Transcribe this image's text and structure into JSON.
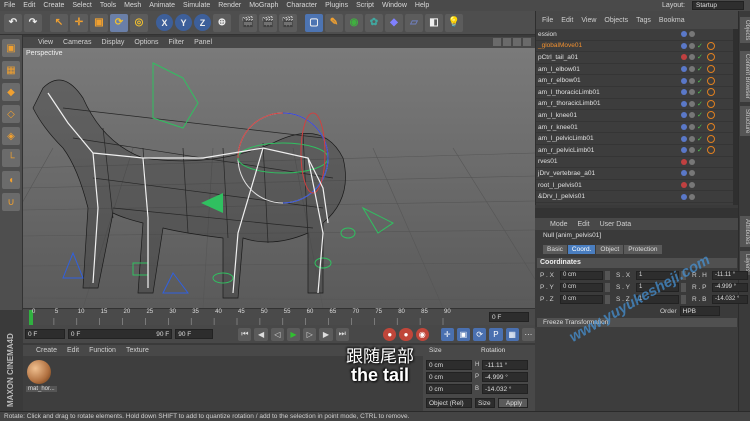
{
  "menubar": {
    "items": [
      "File",
      "Edit",
      "Create",
      "Select",
      "Tools",
      "Mesh",
      "Animate",
      "Simulate",
      "Render",
      "MoGraph",
      "Character",
      "Plugins",
      "Script",
      "Window",
      "Help"
    ],
    "layout_label": "Layout:",
    "layout_value": "Startup"
  },
  "toolbar": {
    "axis_x": "X",
    "axis_y": "Y",
    "axis_z": "Z"
  },
  "viewport": {
    "menu": [
      "View",
      "Cameras",
      "Display",
      "Options",
      "Filter",
      "Panel"
    ],
    "label": "Perspective"
  },
  "timeline": {
    "ticks": [
      "0",
      "5",
      "10",
      "15",
      "20",
      "25",
      "30",
      "35",
      "40",
      "45",
      "50",
      "55",
      "60",
      "65",
      "70",
      "75",
      "80",
      "85",
      "90"
    ],
    "current_frame": "0 F"
  },
  "transport": {
    "start_field": "0 F",
    "start_range": "0 F",
    "end_range": "90 F",
    "end_field": "90 F"
  },
  "material_manager": {
    "menu": [
      "Create",
      "Edit",
      "Function",
      "Texture"
    ],
    "material_name": "mat_hor..."
  },
  "coordinates_manager": {
    "col_size": "Size",
    "col_rotation": "Rotation",
    "size_values": [
      "0 cm",
      "0 cm",
      "0 cm"
    ],
    "rotation_labels": [
      "H",
      "P",
      "B"
    ],
    "rotation_values": [
      "-11.11 °",
      "-4.999 °",
      "-14.032 °"
    ],
    "mode_object": "Object (Rel)",
    "mode_size": "Size",
    "apply": "Apply"
  },
  "subtitle": {
    "chinese": "跟随尾部",
    "english": "the tail"
  },
  "watermark": "www.yuyukesheji.com",
  "object_manager": {
    "menu": [
      "File",
      "Edit",
      "View",
      "Objects",
      "Tags",
      "Bookma"
    ],
    "objects": [
      {
        "name": "ession",
        "highlight": false
      },
      {
        "name": "_globalMove01",
        "highlight": true
      },
      {
        "name": "pCtrl_tail_a01",
        "highlight": false
      },
      {
        "name": "am_l_elbow01",
        "highlight": false
      },
      {
        "name": "am_r_elbow01",
        "highlight": false
      },
      {
        "name": "am_l_thoracicLimb01",
        "highlight": false
      },
      {
        "name": "am_r_thoracicLimb01",
        "highlight": false
      },
      {
        "name": "am_l_knee01",
        "highlight": false
      },
      {
        "name": "am_r_knee01",
        "highlight": false
      },
      {
        "name": "am_l_pelvicLimb01",
        "highlight": false
      },
      {
        "name": "am_r_pelvicLimb01",
        "highlight": false
      },
      {
        "name": "rves01",
        "highlight": false
      },
      {
        "name": "jDrv_vertebrae_a01",
        "highlight": false
      },
      {
        "name": "root_l_pelvis01",
        "highlight": false
      },
      {
        "name": "&Drv_l_pelvis01",
        "highlight": false
      }
    ]
  },
  "attribute_manager": {
    "menu": [
      "Mode",
      "Edit",
      "User Data"
    ],
    "object_line": "Null [anim_pelvis01]",
    "tabs": [
      "Basic",
      "Coord.",
      "Object",
      "Protection"
    ],
    "active_tab": "Coord.",
    "section": "Coordinates",
    "rows": [
      {
        "p_label": "P . X",
        "p_val": "0 cm",
        "s_label": "S . X",
        "s_val": "1",
        "r_label": "R . H",
        "r_val": "-11.11 °"
      },
      {
        "p_label": "P . Y",
        "p_val": "0 cm",
        "s_label": "S . Y",
        "s_val": "1",
        "r_label": "R . P",
        "r_val": "-4.999 °"
      },
      {
        "p_label": "P . Z",
        "p_val": "0 cm",
        "s_label": "S . Z",
        "s_val": "1",
        "r_label": "R . B",
        "r_val": "-14.032 °"
      }
    ],
    "order_label": "Order",
    "order_value": "HPB",
    "freeze": "Freeze Transformation"
  },
  "side_tabs": [
    "Objects",
    "Content Browser",
    "Structure",
    "Attributes",
    "Layers"
  ],
  "status": "Rotate: Click and drag to rotate elements. Hold down SHIFT to add to quantize rotation / add to the selection in point mode, CTRL to remove.",
  "colors": {
    "accent": "#4a7ec0",
    "highlight_object": "#f09030",
    "check": "#50c050"
  }
}
